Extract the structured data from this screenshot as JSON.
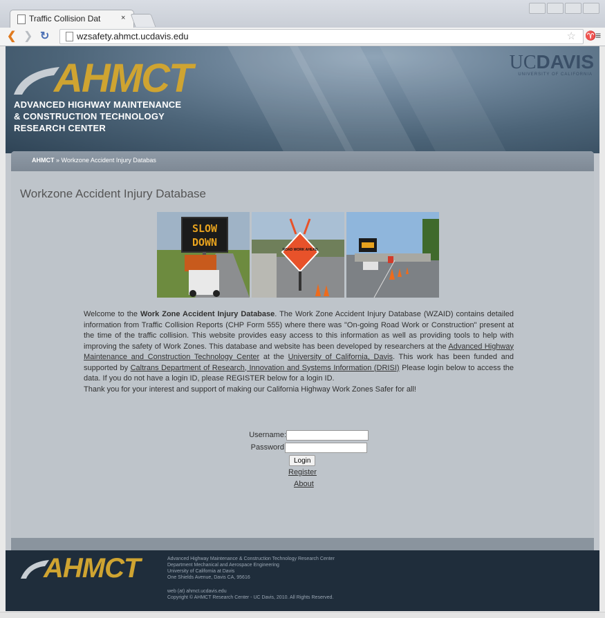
{
  "browser": {
    "tab_title": "Traffic Collision Dat",
    "tab_close": "×",
    "url": "wzsafety.ahmct.ucdavis.edu"
  },
  "header": {
    "logo": "AHMCT",
    "logo_sub_1": "ADVANCED HIGHWAY MAINTENANCE",
    "logo_sub_2": "& CONSTRUCTION TECHNOLOGY",
    "logo_sub_3": "RESEARCH CENTER",
    "uc": "UC",
    "davis": "DAVIS",
    "uc_sub": "UNIVERSITY OF CALIFORNIA"
  },
  "breadcrumb": {
    "home": "AHMCT",
    "sep": " » ",
    "current": "Workzone Accident Injury Databas"
  },
  "page_title": "Workzone Accident Injury Database",
  "banner": {
    "sign_text_1": "SLOW",
    "sign_text_2": "DOWN",
    "diamond_text": "ROAD WORK AHEAD"
  },
  "intro": {
    "p1_pre": "Welcome to the ",
    "p1_bold": "Work Zone Accident Injury Database",
    "p1_mid": ". The Work Zone Accident Injury Database (WZAID) contains detailed information from Traffic Collision Reports (CHP Form 555) where there was \"On-going Road Work or Construction\" present at the time of the traffic collision. This website provides easy access to this information as well as providing tools to help with improving the safety of Work Zones. This database and website has been developed by researchers at the ",
    "link_ahmct": "Advanced Highway Maintenance and Construction Technology Center",
    "p1_at": " at the ",
    "link_uc": "University of California, Davis",
    "p1_funded": ". This work has been funded and supported by ",
    "link_caltrans": "Caltrans Department of Research, Innovation and Systems Information (DRISI)",
    "p1_end": " Please login below to access the data. If you do not have a login ID, please REGISTER below for a login ID.",
    "p2": "Thank you for your interest and support of making our California Highway Work Zones Safer for all!"
  },
  "login": {
    "username_label": "Username:",
    "password_label": "Password:",
    "username_value": "",
    "password_value": "",
    "login_button": "Login",
    "register_link": "Register",
    "about_link": "About"
  },
  "footer": {
    "logo": "AHMCT",
    "line1": "Advanced Highway Maintenance & Construction Technology Research Center",
    "line2": "Department Mechanical and Aerospace Engineering",
    "line3": "University of California at Davis",
    "line4": "One Shields Avenue, Davis CA, 95616",
    "email": "web (at) ahmct.ucdavis.edu",
    "copyright": "Copyright © AHMCT Research Center - UC Davis, 2010. All Rights Reserved."
  },
  "colors": {
    "logo_gold": "#cfa431",
    "header_blue": "#4c6478",
    "footer_navy": "#1f2d3b",
    "content_grey": "#bec4ca"
  }
}
